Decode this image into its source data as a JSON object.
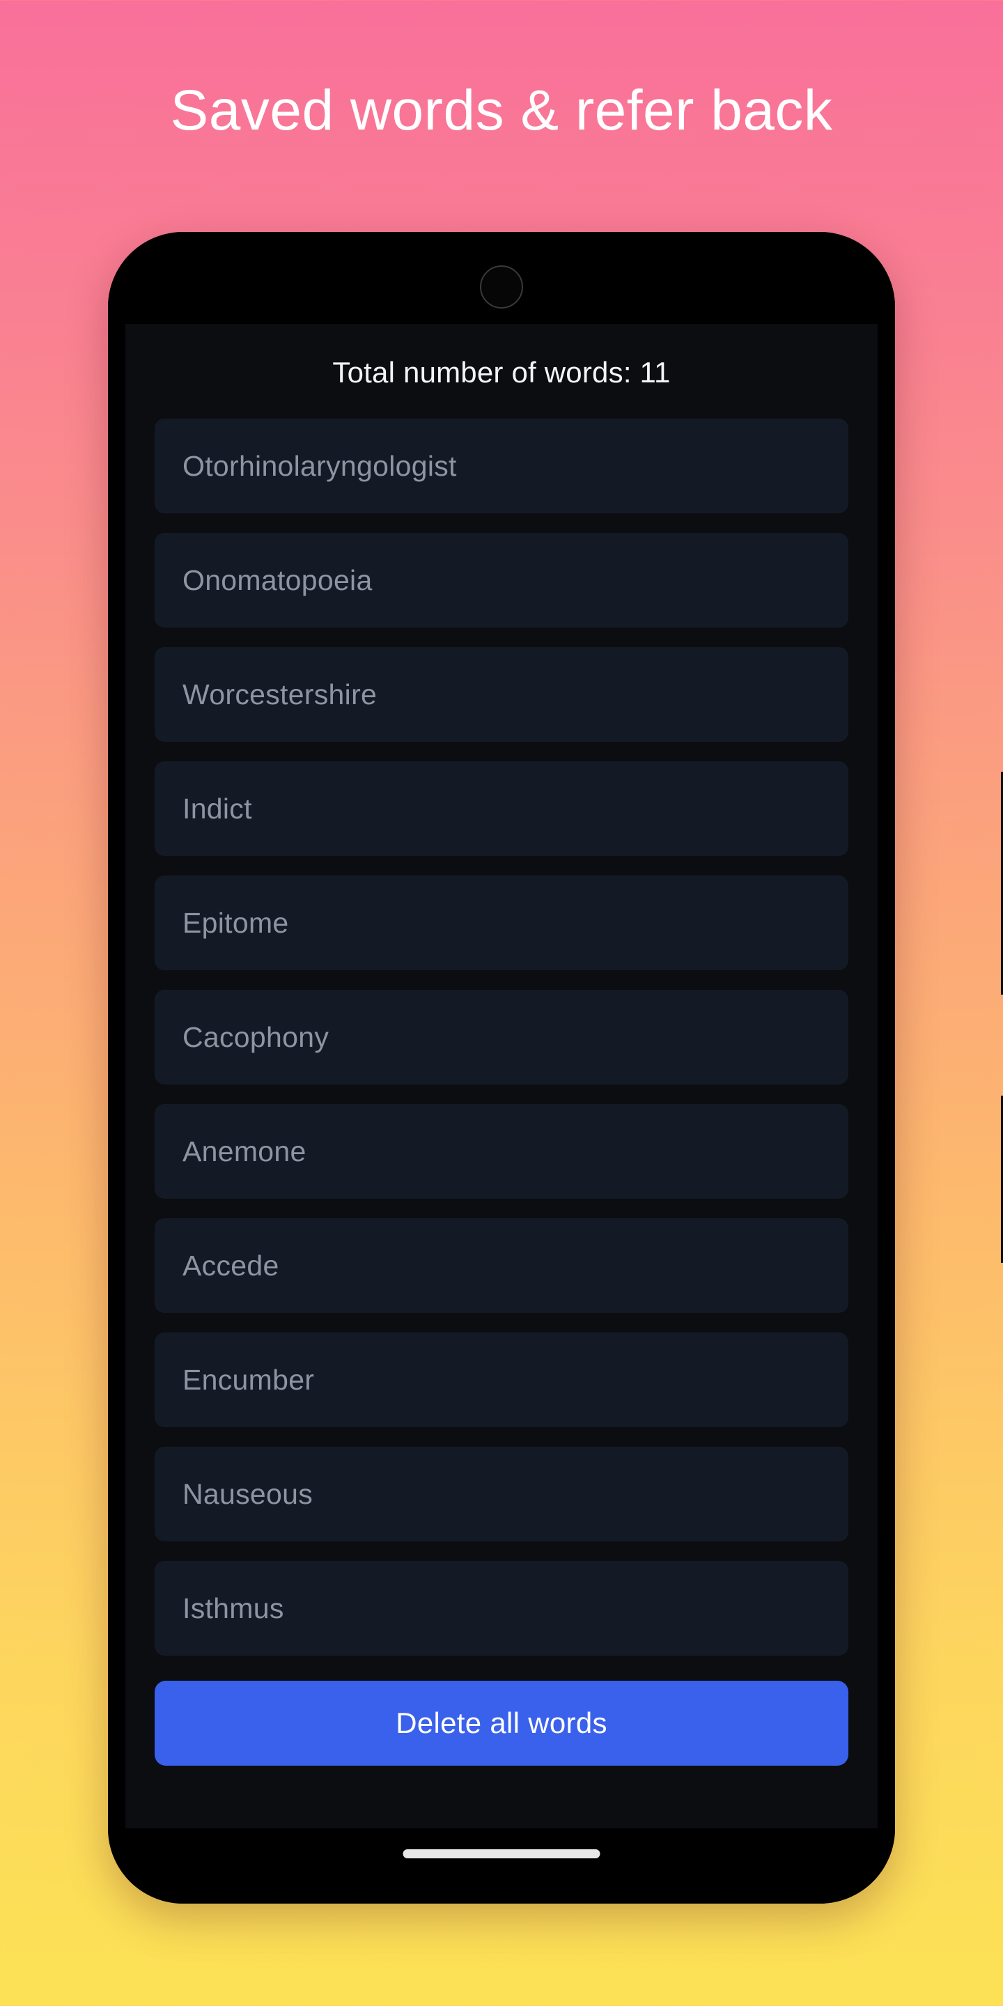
{
  "headline": "Saved words & refer back",
  "theme": {
    "background_top": "#f9709a",
    "background_bottom": "#fce155",
    "screen_background": "#0b0d11",
    "card_background": "#141a25",
    "card_text": "#8d95a2",
    "accent_button": "#3a61ec",
    "headline_text": "#ffffff"
  },
  "phone": {
    "camera_icon": "camera-icon",
    "home_indicator": "home-indicator",
    "side_buttons": [
      "volume-button",
      "power-button"
    ]
  },
  "screen": {
    "total_words_label": "Total number of words: 11",
    "total_words_count": 11,
    "words": [
      "Otorhinolaryngologist",
      "Onomatopoeia",
      "Worcestershire",
      "Indict",
      "Epitome",
      "Cacophony",
      "Anemone",
      "Accede",
      "Encumber",
      "Nauseous",
      "Isthmus"
    ],
    "delete_all_label": "Delete all words"
  }
}
